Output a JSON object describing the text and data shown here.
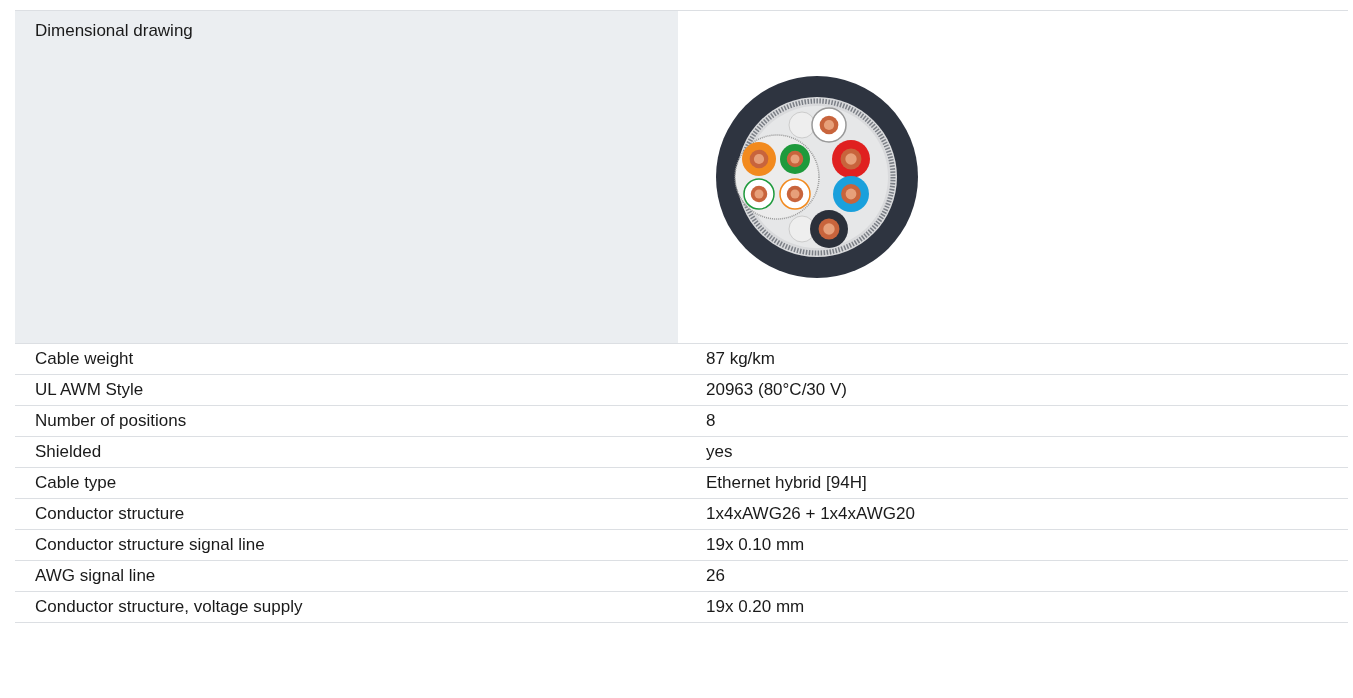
{
  "drawing_row": {
    "label": "Dimensional drawing"
  },
  "rows": [
    {
      "label": "Cable weight",
      "value": "87 kg/km"
    },
    {
      "label": "UL AWM Style",
      "value": "20963 (80°C/30 V)"
    },
    {
      "label": "Number of positions",
      "value": "8"
    },
    {
      "label": "Shielded",
      "value": "yes"
    },
    {
      "label": "Cable type",
      "value": "Ethernet hybrid [94H]"
    },
    {
      "label": "Conductor structure",
      "value": "1x4xAWG26 + 1x4xAWG20"
    },
    {
      "label": "Conductor structure signal line",
      "value": "19x 0.10 mm"
    },
    {
      "label": "AWG signal line",
      "value": "26"
    },
    {
      "label": "Conductor structure, voltage supply",
      "value": "19x 0.20 mm"
    }
  ]
}
